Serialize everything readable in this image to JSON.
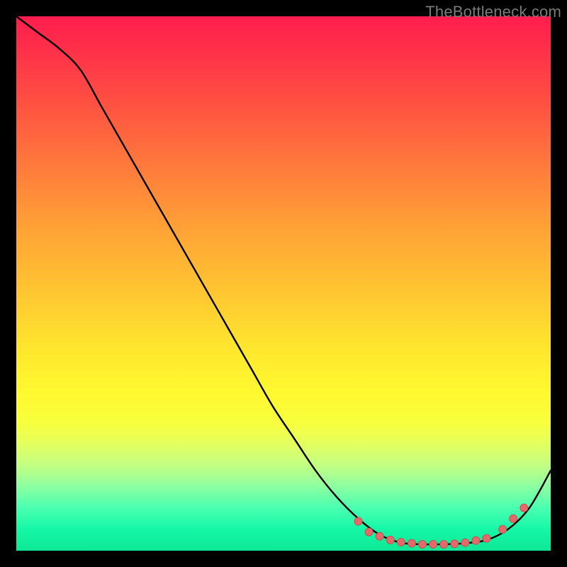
{
  "watermark": "TheBottleneck.com",
  "colors": {
    "background": "#000000",
    "curve_stroke": "#000000",
    "marker_fill": "#e46a6a",
    "marker_stroke": "#c94f52"
  },
  "chart_data": {
    "type": "line",
    "title": "",
    "xlabel": "",
    "ylabel": "",
    "xlim": [
      0,
      100
    ],
    "ylim": [
      0,
      100
    ],
    "series": [
      {
        "name": "curve",
        "x": [
          0,
          4,
          8,
          12,
          16,
          20,
          24,
          28,
          32,
          36,
          40,
          44,
          48,
          52,
          56,
          60,
          64,
          68,
          72,
          76,
          80,
          84,
          88,
          92,
          96,
          100
        ],
        "y": [
          100,
          97,
          94,
          90,
          83,
          76,
          69,
          62,
          55,
          48,
          41,
          34,
          27,
          21,
          15,
          10,
          6,
          3,
          1.5,
          1.2,
          1.2,
          1.4,
          2,
          4,
          8,
          15
        ]
      }
    ],
    "markers": {
      "name": "dots",
      "x": [
        64,
        66,
        68,
        70,
        72,
        74,
        76,
        78,
        80,
        82,
        84,
        86,
        88,
        91,
        93,
        95
      ],
      "y": [
        5.5,
        3.5,
        2.7,
        2,
        1.6,
        1.4,
        1.2,
        1.2,
        1.2,
        1.3,
        1.5,
        1.9,
        2.3,
        4,
        6,
        8
      ]
    }
  }
}
